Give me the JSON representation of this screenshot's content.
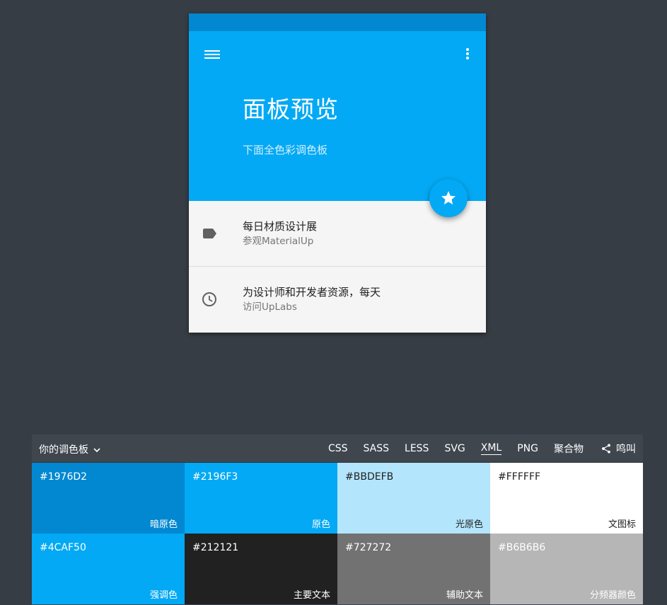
{
  "preview": {
    "title": "面板预览",
    "subtitle": "下面全色彩调色板",
    "colors": {
      "status_bar": "#0288d1",
      "app_bar": "#03a9f4",
      "fab": "#03a9f4"
    },
    "items": [
      {
        "primary": "每日材质设计展",
        "secondary": "参观MaterialUp",
        "icon": "label-icon"
      },
      {
        "primary": "为设计师和开发者资源，每天",
        "secondary": "访问UpLabs",
        "icon": "clock-icon"
      }
    ]
  },
  "toolbar": {
    "palette_label": "你的调色板",
    "formats": [
      "CSS",
      "SASS",
      "LESS",
      "SVG",
      "XML",
      "PNG",
      "聚合物"
    ],
    "active_format": "XML",
    "share_label": "鸣叫"
  },
  "swatches": [
    {
      "hex": "#1976D2",
      "role": "暗原色",
      "bg": "#0288d1",
      "fg": "#ffffff"
    },
    {
      "hex": "#2196F3",
      "role": "原色",
      "bg": "#03a9f4",
      "fg": "#ffffff"
    },
    {
      "hex": "#BBDEFB",
      "role": "光原色",
      "bg": "#b3e5fc",
      "fg": "#212121"
    },
    {
      "hex": "#FFFFFF",
      "role": "文图标",
      "bg": "#ffffff",
      "fg": "#212121"
    },
    {
      "hex": "#4CAF50",
      "role": "强调色",
      "bg": "#03a9f4",
      "fg": "#ffffff"
    },
    {
      "hex": "#212121",
      "role": "主要文本",
      "bg": "#212121",
      "fg": "#ffffff"
    },
    {
      "hex": "#727272",
      "role": "辅助文本",
      "bg": "#727272",
      "fg": "#ffffff"
    },
    {
      "hex": "#B6B6B6",
      "role": "分频器颜色",
      "bg": "#b6b6b6",
      "fg": "#ffffff"
    }
  ]
}
